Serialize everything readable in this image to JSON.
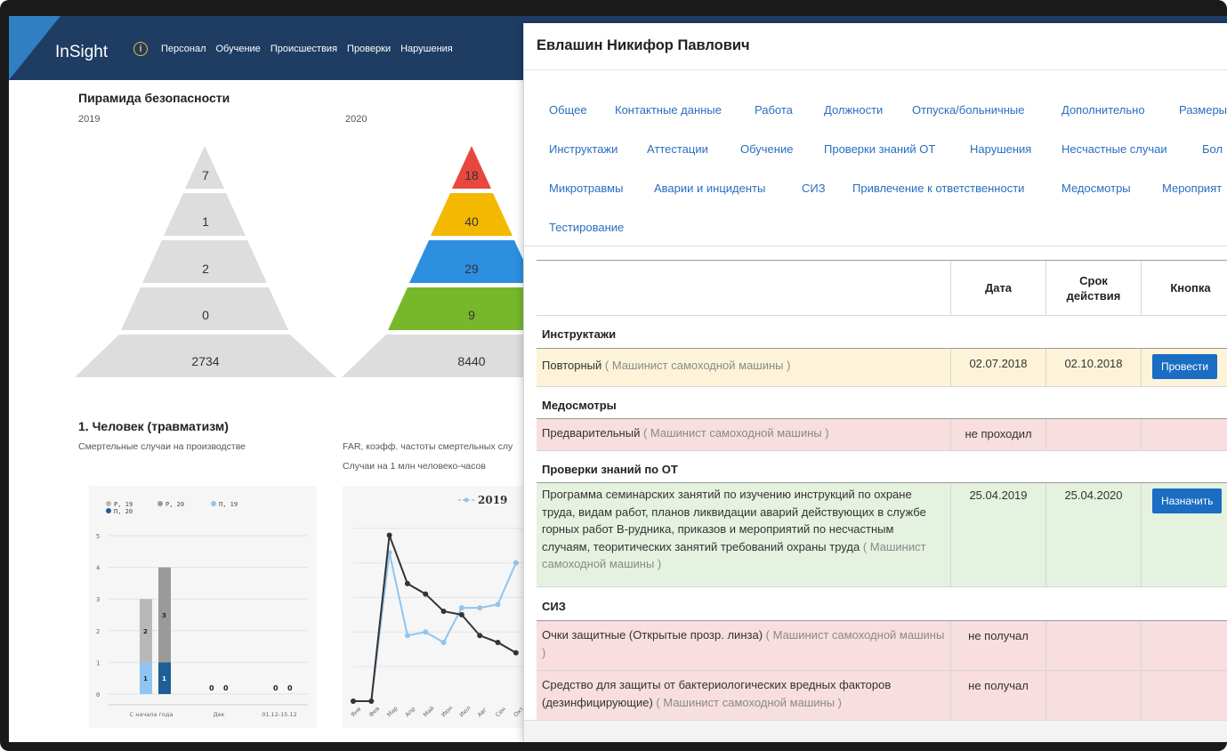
{
  "app": {
    "logo": "InSight",
    "nav": [
      "Персонал",
      "Обучение",
      "Происшествия",
      "Проверки",
      "Нарушения"
    ]
  },
  "dashboard": {
    "title": "Пирамида безопасности",
    "pyramid_2019": {
      "year": "2019",
      "values": [
        "7",
        "1",
        "2",
        "0",
        "2734"
      ]
    },
    "pyramid_2020": {
      "year": "2020",
      "values": [
        "18",
        "40",
        "29",
        "9",
        "8440"
      ],
      "colors": [
        "#e8473f",
        "#f5b800",
        "#2d8fe0",
        "#77b82a",
        "#dddddd"
      ]
    },
    "section_title": "1. Человек (травматизм)",
    "chart1_caption": "Смертельные случаи на производстве",
    "chart2_caption": "FAR, коэфф. частоты смертельных слу",
    "chart2_subcaption": "Случаи на 1 млн человеко-часов"
  },
  "chart_data": [
    {
      "type": "bar",
      "legend": [
        "Р, 19",
        "Р, 20",
        "П, 19",
        "П, 20"
      ],
      "colors": {
        "Р, 19": "#b8b8b8",
        "Р, 20": "#9a9a9a",
        "П, 19": "#8fc5f0",
        "П, 20": "#1d5f96"
      },
      "categories": [
        "С начала года",
        "Дек",
        "01.12-15.12"
      ],
      "y_ticks": [
        "0",
        "1",
        "2",
        "3",
        "4",
        "5"
      ],
      "ylim": [
        0,
        5
      ],
      "series": [
        {
          "name": "Р, 19",
          "values": [
            2,
            0,
            0
          ]
        },
        {
          "name": "П, 19",
          "values": [
            1,
            0,
            0
          ]
        },
        {
          "name": "Р, 20",
          "values": [
            3,
            0,
            0
          ]
        },
        {
          "name": "П, 20",
          "values": [
            1,
            0,
            0
          ]
        }
      ],
      "labels": [
        "2",
        "1",
        "3",
        "1",
        "0",
        "0",
        "0",
        "0"
      ]
    },
    {
      "type": "line",
      "legend": [
        "2019"
      ],
      "x": [
        "Янв",
        "Фев",
        "Мар",
        "Апр",
        "Май",
        "Июн",
        "Июл",
        "Авг",
        "Сен",
        "Окт"
      ],
      "series": [
        {
          "name": "2019",
          "values": [
            0.0,
            0.0,
            4.3,
            1.9,
            2.0,
            1.7,
            2.7,
            2.7,
            2.8,
            4.0
          ]
        },
        {
          "name": "2020",
          "values": [
            0.0,
            0.0,
            4.8,
            3.4,
            3.1,
            2.6,
            2.5,
            1.9,
            1.7,
            1.4
          ]
        }
      ],
      "colors": {
        "2019": "#8fc5f0",
        "2020": "#333333"
      }
    }
  ],
  "modal": {
    "title": "Евлашин Никифор Павлович",
    "tabs": [
      "Общее",
      "Контактные данные",
      "Работа",
      "Должности",
      "Отпуска/больничные",
      "Дополнительно",
      "Размеры",
      "Инструктажи",
      "Аттестации",
      "Обучение",
      "Проверки знаний ОТ",
      "Нарушения",
      "Несчастные случаи",
      "Бол",
      "Микротравмы",
      "Аварии и инциденты",
      "СИЗ",
      "Привлечение к ответственности",
      "Медосмотры",
      "Мероприят",
      "Тестирование"
    ],
    "table": {
      "headers": {
        "date": "Дата",
        "validity": "Срок действия",
        "button": "Кнопка"
      },
      "groups": {
        "briefings": "Инструктажи",
        "medical": "Медосмотры",
        "knowledge": "Проверки знаний по ОТ",
        "ppe": "СИЗ"
      },
      "rows": {
        "briefing_repeat": {
          "name": "Повторный",
          "note": "( Машинист самоходной машины )",
          "date": "02.07.2018",
          "validity": "02.10.2018",
          "button": "Провести"
        },
        "medical_prelim": {
          "name": "Предварительный",
          "note": "( Машинист самоходной машины )",
          "date": "не проходил",
          "validity": ""
        },
        "knowledge_program": {
          "name": "Программа семинарских занятий по изучению инструкций по охране труда, видам работ, планов ликвидации аварий действующих в службе горных работ В-рудника, приказов и мероприятий по несчастным случаям, теоритических занятий требований охраны труда",
          "note": "( Машинист самоходной машины )",
          "date": "25.04.2019",
          "validity": "25.04.2020",
          "button": "Назначить"
        },
        "ppe_goggles": {
          "name": "Очки защитные (Открытые прозр. линза)",
          "note": "( Машинист самоходной машины )",
          "date": "не получал",
          "validity": ""
        },
        "ppe_disinfect": {
          "name": "Средство для защиты от бактериологических вредных факторов (дезинфицирующие)",
          "note": "( Машинист самоходной машины )",
          "date": "не получал",
          "validity": ""
        }
      }
    }
  }
}
